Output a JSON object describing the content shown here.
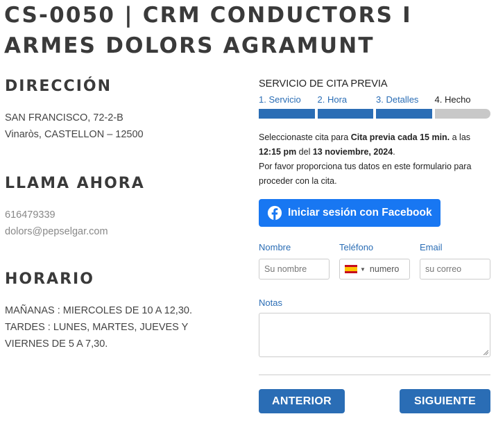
{
  "page_title": "CS-0050 | CRM CONDUCTORS I ARMES DOLORS AGRAMUNT",
  "address": {
    "title": "DIRECCIÓN",
    "line1": "SAN FRANCISCO, 72-2-B",
    "line2": "Vinaròs, CASTELLON – 12500"
  },
  "call": {
    "title": "LLAMA AHORA",
    "phone": "616479339",
    "email": "dolors@pepselgar.com"
  },
  "schedule": {
    "title": "HORARIO",
    "line1": "MAÑANAS : MIERCOLES DE 10 A 12,30.",
    "line2": "TARDES : LUNES, MARTES, JUEVES Y VIERNES DE 5 A 7,30."
  },
  "booking": {
    "title": "SERVICIO DE CITA PREVIA",
    "steps": [
      {
        "label": "1. Servicio",
        "active": true
      },
      {
        "label": "2. Hora",
        "active": true
      },
      {
        "label": "3. Detalles",
        "active": true
      },
      {
        "label": "4. Hecho",
        "active": false
      }
    ],
    "summary": {
      "p1": "Seleccionaste cita para ",
      "service": "Cita previa cada 15 min.",
      "p2": " a las ",
      "time": "12:15 pm",
      "p3": " del ",
      "date": "13 noviembre, 2024",
      "p4": ".",
      "line2": "Por favor proporciona tus datos en este formulario para proceder con la cita."
    },
    "facebook_button": "Iniciar sesión con Facebook",
    "fields": {
      "name_label": "Nombre",
      "name_placeholder": "Su nombre",
      "phone_label": "Teléfono",
      "phone_placeholder": "numero",
      "email_label": "Email",
      "email_placeholder": "su correo",
      "notes_label": "Notas"
    },
    "back_button": "ANTERIOR",
    "next_button": "SIGUIENTE"
  },
  "colors": {
    "accent": "#2a6db5",
    "facebook": "#1877f2",
    "inactive_step": "#c8c8c8"
  }
}
